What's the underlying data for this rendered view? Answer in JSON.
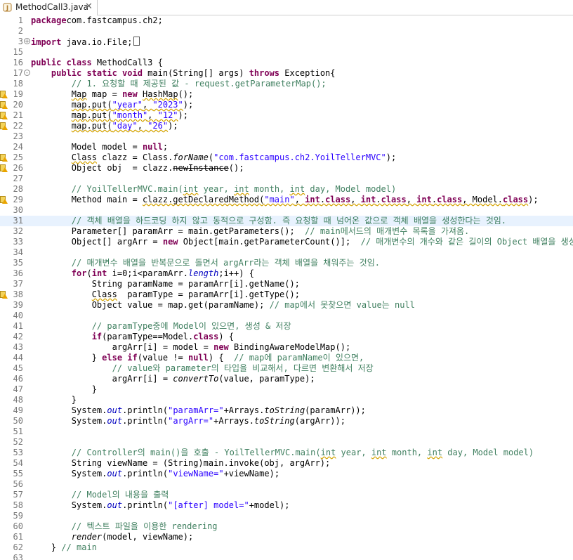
{
  "tab": {
    "label": "MethodCall3.java",
    "close": "✕",
    "icon": "java-file-icon"
  },
  "colors": {
    "keyword": "#7f0055",
    "comment": "#3f7f5f",
    "string": "#2a00ff",
    "field": "#0000c0",
    "line_number": "#787878",
    "highlight": "#e8f2fe",
    "warning": "#f3d35a"
  },
  "icons": {
    "fold": "fold-toggle-icon",
    "warning": "warning-marker-icon"
  },
  "lines": [
    {
      "n": "1",
      "t": [
        [
          "kw",
          "package"
        ],
        [
          "",
          "com.fastcampus.ch2;"
        ]
      ]
    },
    {
      "n": "2",
      "t": []
    },
    {
      "n": "3",
      "fold": "+",
      "t": [
        [
          "kw",
          "import"
        ],
        [
          "",
          " java.io.File;"
        ]
      ],
      "box": true
    },
    {
      "n": "15",
      "t": []
    },
    {
      "n": "16",
      "t": [
        [
          "kw",
          "public class"
        ],
        [
          "",
          " MethodCall3 {"
        ]
      ]
    },
    {
      "n": "17",
      "fold": "-",
      "t": [
        [
          "",
          "    "
        ],
        [
          "kw",
          "public static void"
        ],
        [
          "",
          " main(String[] args) "
        ],
        [
          "kw",
          "throws"
        ],
        [
          "",
          " Exception{"
        ]
      ]
    },
    {
      "n": "18",
      "t": [
        [
          "",
          "        "
        ],
        [
          "cm",
          "// 1. 요청할 때 제공된 값 - request.getParameterMap();"
        ]
      ]
    },
    {
      "n": "19",
      "w": true,
      "t": [
        [
          "",
          "        "
        ],
        [
          "wv",
          "Map"
        ],
        [
          "",
          " map = "
        ],
        [
          "kw",
          "new"
        ],
        [
          "",
          " "
        ],
        [
          "wv",
          "HashMap"
        ],
        [
          "",
          "();"
        ]
      ]
    },
    {
      "n": "20",
      "w": true,
      "t": [
        [
          "",
          "        "
        ],
        [
          "wv",
          "map.put("
        ],
        [
          "st wv",
          "\"year\""
        ],
        [
          "wv",
          ", "
        ],
        [
          "st wv",
          "\"2023\""
        ],
        [
          "",
          "); "
        ]
      ]
    },
    {
      "n": "21",
      "w": true,
      "t": [
        [
          "",
          "        "
        ],
        [
          "wv",
          "map.put("
        ],
        [
          "st wv",
          "\"month\""
        ],
        [
          "wv",
          ", "
        ],
        [
          "st wv",
          "\"12\""
        ],
        [
          "",
          "); "
        ]
      ]
    },
    {
      "n": "22",
      "w": true,
      "t": [
        [
          "",
          "        "
        ],
        [
          "wv",
          "map.put("
        ],
        [
          "st wv",
          "\"day\""
        ],
        [
          "wv",
          ", "
        ],
        [
          "st wv",
          "\"26\""
        ],
        [
          "",
          "); "
        ]
      ]
    },
    {
      "n": "23",
      "t": []
    },
    {
      "n": "24",
      "t": [
        [
          "",
          "        Model model = "
        ],
        [
          "kw",
          "null"
        ],
        [
          "",
          ";"
        ]
      ]
    },
    {
      "n": "25",
      "w": true,
      "t": [
        [
          "",
          "        "
        ],
        [
          "wv",
          "Class"
        ],
        [
          "",
          " clazz = Class."
        ],
        [
          "sm",
          "forName"
        ],
        [
          "",
          "("
        ],
        [
          "st",
          "\"com.fastcampus.ch2.YoilTellerMVC\""
        ],
        [
          "",
          ");"
        ]
      ]
    },
    {
      "n": "26",
      "w": true,
      "t": [
        [
          "",
          "        Object obj  = clazz."
        ],
        [
          "st2 wv",
          "newInstance"
        ],
        [
          "",
          "();"
        ]
      ]
    },
    {
      "n": "27",
      "t": []
    },
    {
      "n": "28",
      "t": [
        [
          "",
          "        "
        ],
        [
          "cm",
          "// YoilTellerMVC.main("
        ],
        [
          "cm wv",
          "int"
        ],
        [
          "cm",
          " year, "
        ],
        [
          "cm wv",
          "int"
        ],
        [
          "cm",
          " month, "
        ],
        [
          "cm wv",
          "int"
        ],
        [
          "cm",
          " day, Model model)"
        ]
      ]
    },
    {
      "n": "29",
      "w": true,
      "t": [
        [
          "",
          "        Method main = "
        ],
        [
          "wv",
          "clazz.getDeclaredMethod("
        ],
        [
          "st wv",
          "\"main\""
        ],
        [
          "wv",
          ", "
        ],
        [
          "kw wv",
          "int"
        ],
        [
          "wv",
          "."
        ],
        [
          "kw wv",
          "class"
        ],
        [
          "wv",
          ", "
        ],
        [
          "kw wv",
          "int"
        ],
        [
          "wv",
          "."
        ],
        [
          "kw wv",
          "class"
        ],
        [
          "wv",
          ", "
        ],
        [
          "kw wv",
          "int"
        ],
        [
          "wv",
          "."
        ],
        [
          "kw wv",
          "class"
        ],
        [
          "wv",
          ", Model."
        ],
        [
          "kw wv",
          "class"
        ],
        [
          "",
          ");"
        ]
      ]
    },
    {
      "n": "30",
      "t": []
    },
    {
      "n": "31",
      "hl": true,
      "t": [
        [
          "",
          "        "
        ],
        [
          "cm",
          "// 객체 배열을 하드코딩 하지 않고 동적으로 구성함. 즉 요청할 때 넘어온 값으로 객체 배열을 생성한다는 것임."
        ]
      ]
    },
    {
      "n": "32",
      "t": [
        [
          "",
          "        Parameter[] paramArr = main.getParameters();  "
        ],
        [
          "cm",
          "// main메서드의 매개변수 목록을 가져옴."
        ]
      ]
    },
    {
      "n": "33",
      "t": [
        [
          "",
          "        Object[] argArr = "
        ],
        [
          "kw",
          "new"
        ],
        [
          "",
          " Object[main.getParameterCount()];  "
        ],
        [
          "cm",
          "// 매개변수의 개수와 같은 길이의 Object 배열을 생성함."
        ]
      ]
    },
    {
      "n": "34",
      "t": []
    },
    {
      "n": "35",
      "t": [
        [
          "",
          "        "
        ],
        [
          "cm",
          "// 매개변수 배열을 반복문으로 돌면서 argArr라는 객체 배열을 채워주는 것임."
        ]
      ]
    },
    {
      "n": "36",
      "t": [
        [
          "",
          "        "
        ],
        [
          "kw",
          "for"
        ],
        [
          "",
          "("
        ],
        [
          "kw",
          "int"
        ],
        [
          "",
          " i=0;i<paramArr."
        ],
        [
          "fd",
          "length"
        ],
        [
          "",
          ";i++) {"
        ]
      ]
    },
    {
      "n": "37",
      "t": [
        [
          "",
          "            String paramName = paramArr[i].getName();"
        ]
      ]
    },
    {
      "n": "38",
      "w": true,
      "t": [
        [
          "",
          "            "
        ],
        [
          "wv",
          "Class"
        ],
        [
          "",
          "  paramType = paramArr[i].getType();"
        ]
      ]
    },
    {
      "n": "39",
      "t": [
        [
          "",
          "            Object value = map.get(paramName); "
        ],
        [
          "cm",
          "// map에서 못찾으면 value는 null"
        ]
      ]
    },
    {
      "n": "40",
      "t": []
    },
    {
      "n": "41",
      "t": [
        [
          "",
          "            "
        ],
        [
          "cm",
          "// paramType중에 Model이 있으면, 생성 & 저장"
        ]
      ]
    },
    {
      "n": "42",
      "t": [
        [
          "",
          "            "
        ],
        [
          "kw",
          "if"
        ],
        [
          "",
          "(paramType==Model."
        ],
        [
          "kw",
          "class"
        ],
        [
          "",
          ") {"
        ]
      ]
    },
    {
      "n": "43",
      "t": [
        [
          "",
          "                argArr[i] = model = "
        ],
        [
          "kw",
          "new"
        ],
        [
          "",
          " BindingAwareModelMap();"
        ]
      ]
    },
    {
      "n": "44",
      "t": [
        [
          "",
          "            } "
        ],
        [
          "kw",
          "else if"
        ],
        [
          "",
          "(value != "
        ],
        [
          "kw",
          "null"
        ],
        [
          "",
          ") {  "
        ],
        [
          "cm",
          "// map에 paramName이 있으면,"
        ]
      ]
    },
    {
      "n": "45",
      "t": [
        [
          "",
          "                "
        ],
        [
          "cm",
          "// value와 parameter의 타입을 비교해서, 다르면 변환해서 저장"
        ]
      ]
    },
    {
      "n": "46",
      "t": [
        [
          "",
          "                argArr[i] = "
        ],
        [
          "sm",
          "convertTo"
        ],
        [
          "",
          "(value, paramType);"
        ]
      ]
    },
    {
      "n": "47",
      "t": [
        [
          "",
          "            }"
        ]
      ]
    },
    {
      "n": "48",
      "t": [
        [
          "",
          "        }"
        ]
      ]
    },
    {
      "n": "49",
      "t": [
        [
          "",
          "        System."
        ],
        [
          "fd",
          "out"
        ],
        [
          "",
          ".println("
        ],
        [
          "st",
          "\"paramArr=\""
        ],
        [
          "",
          "+Arrays."
        ],
        [
          "sm",
          "toString"
        ],
        [
          "",
          "(paramArr));"
        ]
      ]
    },
    {
      "n": "50",
      "t": [
        [
          "",
          "        System."
        ],
        [
          "fd",
          "out"
        ],
        [
          "",
          ".println("
        ],
        [
          "st",
          "\"argArr=\""
        ],
        [
          "",
          "+Arrays."
        ],
        [
          "sm",
          "toString"
        ],
        [
          "",
          "(argArr));"
        ]
      ]
    },
    {
      "n": "51",
      "t": []
    },
    {
      "n": "52",
      "t": []
    },
    {
      "n": "53",
      "t": [
        [
          "",
          "        "
        ],
        [
          "cm",
          "// Controller의 main()을 호출 - YoilTellerMVC.main("
        ],
        [
          "cm wv",
          "int"
        ],
        [
          "cm",
          " year, "
        ],
        [
          "cm wv",
          "int"
        ],
        [
          "cm",
          " month, "
        ],
        [
          "cm wv",
          "int"
        ],
        [
          "cm",
          " day, Model model)"
        ]
      ]
    },
    {
      "n": "54",
      "t": [
        [
          "",
          "        String viewName = (String)main.invoke(obj, argArr);"
        ]
      ]
    },
    {
      "n": "55",
      "t": [
        [
          "",
          "        System."
        ],
        [
          "fd",
          "out"
        ],
        [
          "",
          ".println("
        ],
        [
          "st",
          "\"viewName=\""
        ],
        [
          "",
          "+viewName);"
        ]
      ]
    },
    {
      "n": "56",
      "t": []
    },
    {
      "n": "57",
      "t": [
        [
          "",
          "        "
        ],
        [
          "cm",
          "// Model의 내용을 출력"
        ]
      ]
    },
    {
      "n": "58",
      "t": [
        [
          "",
          "        System."
        ],
        [
          "fd",
          "out"
        ],
        [
          "",
          ".println("
        ],
        [
          "st",
          "\"[after] model=\""
        ],
        [
          "",
          "+model);"
        ]
      ]
    },
    {
      "n": "59",
      "t": []
    },
    {
      "n": "60",
      "t": [
        [
          "",
          "        "
        ],
        [
          "cm",
          "// 텍스트 파일을 이용한 rendering"
        ]
      ]
    },
    {
      "n": "61",
      "t": [
        [
          "",
          "        "
        ],
        [
          "sm",
          "render"
        ],
        [
          "",
          "(model, viewName);"
        ]
      ]
    },
    {
      "n": "62",
      "t": [
        [
          "",
          "    } "
        ],
        [
          "cm",
          "// main"
        ]
      ]
    },
    {
      "n": "63",
      "t": []
    }
  ]
}
